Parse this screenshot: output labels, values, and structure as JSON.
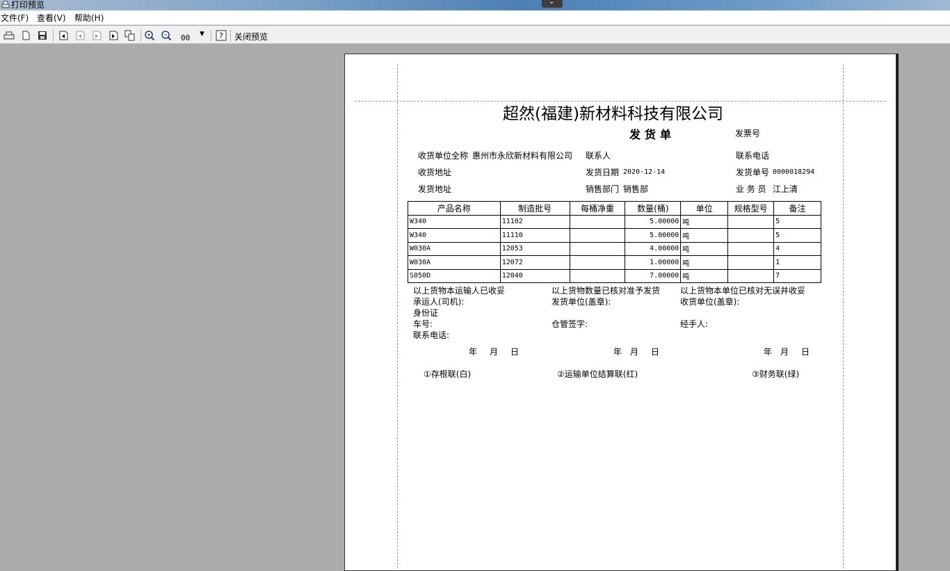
{
  "window": {
    "title": "打印预览"
  },
  "menu": {
    "file": "文件(F)",
    "view": "查看(V)",
    "help": "帮助(H)"
  },
  "toolbar": {
    "zoom_value": "00",
    "close_preview": "关闭预览"
  },
  "document": {
    "company": "超然(福建)新材料科技有限公司",
    "title": "发货单",
    "invoice_no_label": "发票号",
    "consignee_label": "收货单位全称",
    "consignee_value": "惠州市永欣新材料有限公司",
    "contact_label": "联系人",
    "phone_label": "联系电话",
    "receive_addr_label": "收货地址",
    "ship_date_label": "发货日期",
    "ship_date_value": "2020-12-14",
    "ship_no_label": "发货单号",
    "ship_no_value": "0000018294",
    "ship_addr_label": "发货地址",
    "sales_dept_label": "销售部门",
    "sales_dept_value": "销售部",
    "salesman_label": "业 务 员",
    "salesman_value": "江上清",
    "table": {
      "headers": [
        "产品名称",
        "制造批号",
        "每桶净重",
        "数量(桶)",
        "单位",
        "规格型号",
        "备注"
      ],
      "rows": [
        [
          "W340",
          "11102",
          "",
          "5.00000",
          "吨",
          "",
          "5"
        ],
        [
          "W340",
          "11110",
          "",
          "5.00000",
          "吨",
          "",
          "5"
        ],
        [
          "W030A",
          "12053",
          "",
          "4.00000",
          "吨",
          "",
          "4"
        ],
        [
          "W030A",
          "12072",
          "",
          "1.00000",
          "吨",
          "",
          "1"
        ],
        [
          "S050D",
          "12040",
          "",
          "7.00000",
          "吨",
          "",
          "7"
        ]
      ]
    },
    "footer": {
      "col1_note": "以上货物本运输人已收妥",
      "col2_note": "以上货物数量已核对准予发货",
      "col3_note": "以上货物本单位已核对无误并收妥",
      "carrier_label": "承运人(司机):",
      "id_label": "身份证",
      "plate_label": "车号:",
      "contact_phone_label": "联系电话:",
      "ship_unit_label": "发货单位(盖章):",
      "warehouse_label": "仓管签字:",
      "receive_unit_label": "收货单位(盖章):",
      "handler_label": "经手人:",
      "date_year": "年",
      "date_month": "月",
      "date_day": "日",
      "copy1": "①存根联(白)",
      "copy2": "②运输单位结算联(红)",
      "copy3": "③财务联(绿)"
    }
  }
}
